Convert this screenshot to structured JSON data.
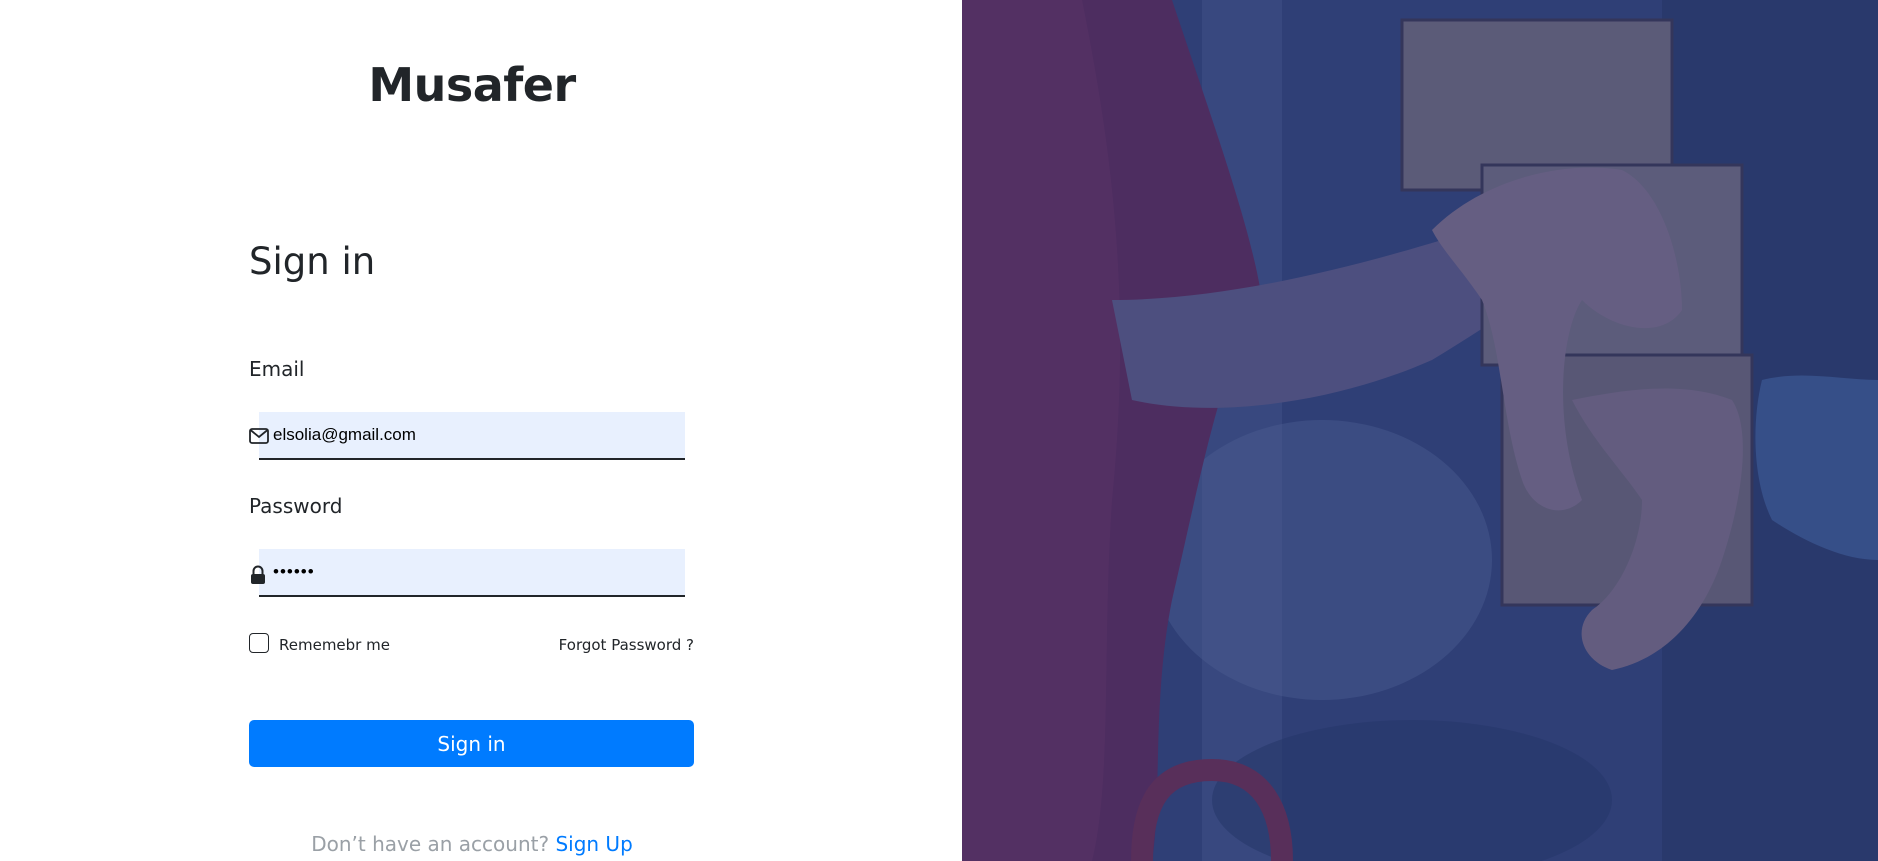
{
  "brand": {
    "name": "Musafer"
  },
  "form": {
    "title": "Sign in",
    "email": {
      "label": "Email",
      "value": "elsolia@gmail.com",
      "icon": "envelope-icon"
    },
    "password": {
      "label": "Password",
      "value": "••••••",
      "icon": "lock-icon"
    },
    "remember": {
      "label": "Rememebr me",
      "checked": false
    },
    "forgot_label": "Forgot Password ?",
    "submit_label": "Sign in",
    "signup_prompt": "Don’t have an account?",
    "signup_link": "Sign Up"
  },
  "colors": {
    "primary": "#007bff",
    "input_bg": "#e8f0fe",
    "overlay": "#2f3e6c",
    "text": "#212529",
    "muted": "#9aa0a6"
  }
}
